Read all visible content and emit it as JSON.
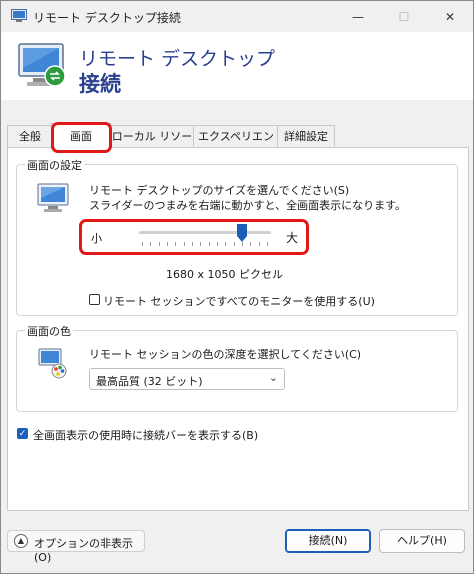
{
  "window": {
    "title": "リモート デスクトップ接続"
  },
  "titlebar": {
    "minimize": "—",
    "maximize": "☐",
    "close": "✕"
  },
  "header": {
    "line1": "リモート デスクトップ",
    "line2": "接続"
  },
  "tabs": [
    {
      "label": "全般"
    },
    {
      "label": "画面",
      "active": true
    },
    {
      "label": "ローカル リソース"
    },
    {
      "label": "エクスペリエンス"
    },
    {
      "label": "詳細設定"
    }
  ],
  "display_settings": {
    "title": "画面の設定",
    "desc_line1": "リモート デスクトップのサイズを選んでください(S)",
    "desc_line2": "スライダーのつまみを右端に動かすと、全画面表示になります。",
    "slider": {
      "min_label": "小",
      "max_label": "大",
      "level": 0.8
    },
    "resolution": "1680 x 1050 ピクセル",
    "all_monitors_label": "リモート セッションですべてのモニターを使用する(U)",
    "all_monitors_checked": false
  },
  "colors": {
    "title": "画面の色",
    "desc": "リモート セッションの色の深度を選択してください(C)",
    "selected": "最高品質 (32 ビット)"
  },
  "connection_bar": {
    "label": "全画面表示の使用時に接続バーを表示する(B)",
    "checked": true
  },
  "footer": {
    "options_label": "オプションの非表示(O)",
    "connect_label": "接続(N)",
    "help_label": "ヘルプ(H)"
  },
  "theme": {
    "accent": "#1c5fb8",
    "highlight": "#e01818",
    "title_blue": "#2b3f8f"
  }
}
